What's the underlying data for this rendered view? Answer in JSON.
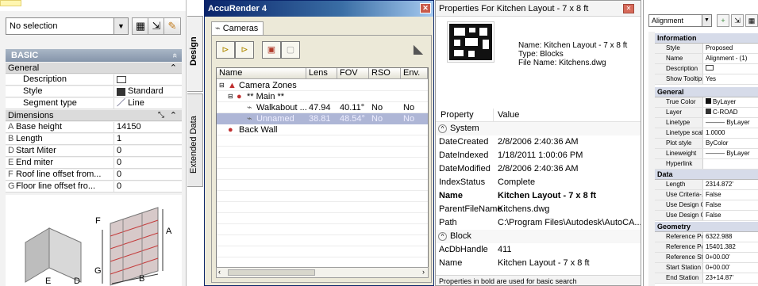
{
  "design_palette": {
    "selection": "No selection",
    "basic_header": "BASIC",
    "basic_chevron": "«",
    "general_header": "General",
    "general_rows": [
      {
        "label": "Description",
        "value": ""
      },
      {
        "label": "Style",
        "value": "Standard"
      },
      {
        "label": "Segment type",
        "value": "Line"
      }
    ],
    "dimensions_header": "Dimensions",
    "dimension_rows": [
      {
        "letter": "A",
        "label": "Base height",
        "value": "14150"
      },
      {
        "letter": "B",
        "label": "Length",
        "value": "1"
      },
      {
        "letter": "D",
        "label": "Start Miter",
        "value": "0"
      },
      {
        "letter": "E",
        "label": "End miter",
        "value": "0"
      },
      {
        "letter": "F",
        "label": "Roof line offset from...",
        "value": "0"
      },
      {
        "letter": "G",
        "label": "Floor line offset fro...",
        "value": "0"
      }
    ],
    "diagram_letters": [
      "F",
      "A",
      "G",
      "B",
      "E",
      "D"
    ],
    "tab_design": "Design",
    "tab_extended": "Extended Data"
  },
  "accurender": {
    "title": "AccuRender 4",
    "tab": "Cameras",
    "columns": [
      "Name",
      "Lens",
      "FOV",
      "RSO",
      "Env."
    ],
    "rows": [
      {
        "name": "Camera Zones",
        "lens": "",
        "fov": "",
        "rso": "",
        "env": ""
      },
      {
        "name": "** Main **",
        "lens": "",
        "fov": "",
        "rso": "",
        "env": ""
      },
      {
        "name": "Walkabout ...",
        "lens": "47.94",
        "fov": "40.11°",
        "rso": "No",
        "env": "No"
      },
      {
        "name": "Unnamed",
        "lens": "38.81",
        "fov": "48.54°",
        "rso": "No",
        "env": "No"
      },
      {
        "name": "Back Wall",
        "lens": "",
        "fov": "",
        "rso": "",
        "env": ""
      }
    ]
  },
  "properties": {
    "title": "Properties For Kitchen Layout - 7 x 8 ft",
    "info_name": "Name: Kitchen Layout - 7 x 8 ft",
    "info_type": "Type: Blocks",
    "info_file": "File Name: Kitchens.dwg",
    "col_property": "Property",
    "col_value": "Value",
    "group_system": "System",
    "system_rows": [
      {
        "k": "DateCreated",
        "v": "2/8/2006 2:40:36 AM"
      },
      {
        "k": "DateIndexed",
        "v": "1/18/2011 1:00:06 PM"
      },
      {
        "k": "DateModified",
        "v": "2/8/2006 2:40:36 AM"
      },
      {
        "k": "IndexStatus",
        "v": "Complete"
      },
      {
        "k": "Name",
        "v": "Kitchen Layout - 7 x 8 ft"
      },
      {
        "k": "ParentFileName",
        "v": "Kitchens.dwg"
      },
      {
        "k": "Path",
        "v": "C:\\Program Files\\Autodesk\\AutoCA..."
      }
    ],
    "group_block": "Block",
    "block_rows": [
      {
        "k": "AcDbHandle",
        "v": "411"
      },
      {
        "k": "Name",
        "v": "Kitchen Layout - 7 x 8 ft"
      }
    ],
    "footer": "Properties in bold are used for basic search"
  },
  "alignment_props": {
    "dropdown": "Alignment",
    "cat_information": "Information",
    "information_rows": [
      {
        "k": "Style",
        "v": "Proposed"
      },
      {
        "k": "Name",
        "v": "Alignment - (1)"
      },
      {
        "k": "Description",
        "v": ""
      },
      {
        "k": "Show Tooltips",
        "v": "Yes"
      }
    ],
    "cat_general": "General",
    "general_rows": [
      {
        "k": "True Color",
        "v": "ByLayer"
      },
      {
        "k": "Layer",
        "v": "C-ROAD"
      },
      {
        "k": "Linetype",
        "v": "——— ByLayer"
      },
      {
        "k": "Linetype scale",
        "v": "1.0000"
      },
      {
        "k": "Plot style",
        "v": "ByColor"
      },
      {
        "k": "Lineweight",
        "v": "——— ByLayer"
      },
      {
        "k": "Hyperlink",
        "v": ""
      }
    ],
    "cat_data": "Data",
    "data_rows": [
      {
        "k": "Length",
        "v": "2314.872'"
      },
      {
        "k": "Use Criteria-...",
        "v": "False"
      },
      {
        "k": "Use Design C...",
        "v": "False"
      },
      {
        "k": "Use Design C...",
        "v": "False"
      }
    ],
    "cat_geometry": "Geometry",
    "geometry_rows": [
      {
        "k": "Reference Po...",
        "v": "6322.988"
      },
      {
        "k": "Reference Po...",
        "v": "15401.382"
      },
      {
        "k": "Reference St...",
        "v": "0+00.00'"
      },
      {
        "k": "Start Station",
        "v": "0+00.00'"
      },
      {
        "k": "End Station",
        "v": "23+14.87'"
      }
    ]
  }
}
